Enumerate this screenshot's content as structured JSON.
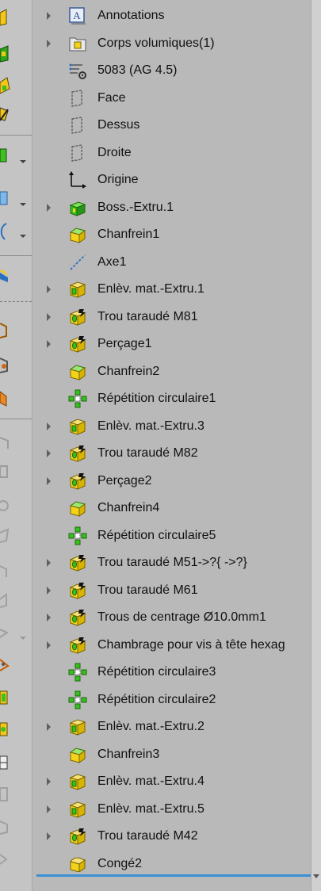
{
  "tree": {
    "items": [
      {
        "label": "Annotations",
        "icon": "annotations-icon",
        "expandable": true
      },
      {
        "label": "Corps volumiques(1)",
        "icon": "solid-bodies-folder-icon",
        "expandable": true
      },
      {
        "label": "5083 (AG 4.5)",
        "icon": "material-icon",
        "expandable": false
      },
      {
        "label": "Face",
        "icon": "plane-icon",
        "expandable": false
      },
      {
        "label": "Dessus",
        "icon": "plane-icon",
        "expandable": false
      },
      {
        "label": "Droite",
        "icon": "plane-icon",
        "expandable": false
      },
      {
        "label": "Origine",
        "icon": "origin-icon",
        "expandable": false
      },
      {
        "label": "Boss.-Extru.1",
        "icon": "boss-extrude-icon",
        "expandable": true
      },
      {
        "label": "Chanfrein1",
        "icon": "chamfer-icon",
        "expandable": false
      },
      {
        "label": "Axe1",
        "icon": "axis-icon",
        "expandable": false
      },
      {
        "label": "Enlèv. mat.-Extru.1",
        "icon": "cut-extrude-icon",
        "expandable": true
      },
      {
        "label": "Trou taraudé M81",
        "icon": "hole-wizard-icon",
        "expandable": true
      },
      {
        "label": "Perçage1",
        "icon": "hole-wizard-icon",
        "expandable": true
      },
      {
        "label": "Chanfrein2",
        "icon": "chamfer-icon",
        "expandable": false
      },
      {
        "label": "Répétition circulaire1",
        "icon": "circular-pattern-icon",
        "expandable": false
      },
      {
        "label": "Enlèv. mat.-Extru.3",
        "icon": "cut-extrude-icon",
        "expandable": true
      },
      {
        "label": "Trou taraudé M82",
        "icon": "hole-wizard-icon",
        "expandable": true
      },
      {
        "label": "Perçage2",
        "icon": "hole-wizard-icon",
        "expandable": true
      },
      {
        "label": "Chanfrein4",
        "icon": "chamfer-icon",
        "expandable": false
      },
      {
        "label": "Répétition circulaire5",
        "icon": "circular-pattern-icon",
        "expandable": false
      },
      {
        "label": "Trou taraudé M51->?{ ->?}",
        "icon": "hole-wizard-icon",
        "expandable": true
      },
      {
        "label": "Trou taraudé M61",
        "icon": "hole-wizard-icon",
        "expandable": true
      },
      {
        "label": "Trous de centrage Ø10.0mm1",
        "icon": "hole-wizard-icon",
        "expandable": true
      },
      {
        "label": "Chambrage pour vis à tête hexag",
        "icon": "hole-wizard-icon",
        "expandable": true
      },
      {
        "label": "Répétition circulaire3",
        "icon": "circular-pattern-icon",
        "expandable": false
      },
      {
        "label": "Répétition circulaire2",
        "icon": "circular-pattern-icon",
        "expandable": false
      },
      {
        "label": "Enlèv. mat.-Extru.2",
        "icon": "cut-extrude-icon",
        "expandable": true
      },
      {
        "label": "Chanfrein3",
        "icon": "chamfer-icon",
        "expandable": false
      },
      {
        "label": "Enlèv. mat.-Extru.4",
        "icon": "cut-extrude-icon",
        "expandable": true
      },
      {
        "label": "Enlèv. mat.-Extru.5",
        "icon": "cut-extrude-icon",
        "expandable": true
      },
      {
        "label": "Trou taraudé M42",
        "icon": "hole-wizard-icon",
        "expandable": true
      },
      {
        "label": "Congé2",
        "icon": "fillet-icon",
        "expandable": false
      }
    ]
  },
  "colors": {
    "tree_background": "#b9b9b9",
    "feature_yellow": "#f2d21a",
    "feature_green": "#35c01f",
    "selection_bar": "#3a8fd6"
  }
}
